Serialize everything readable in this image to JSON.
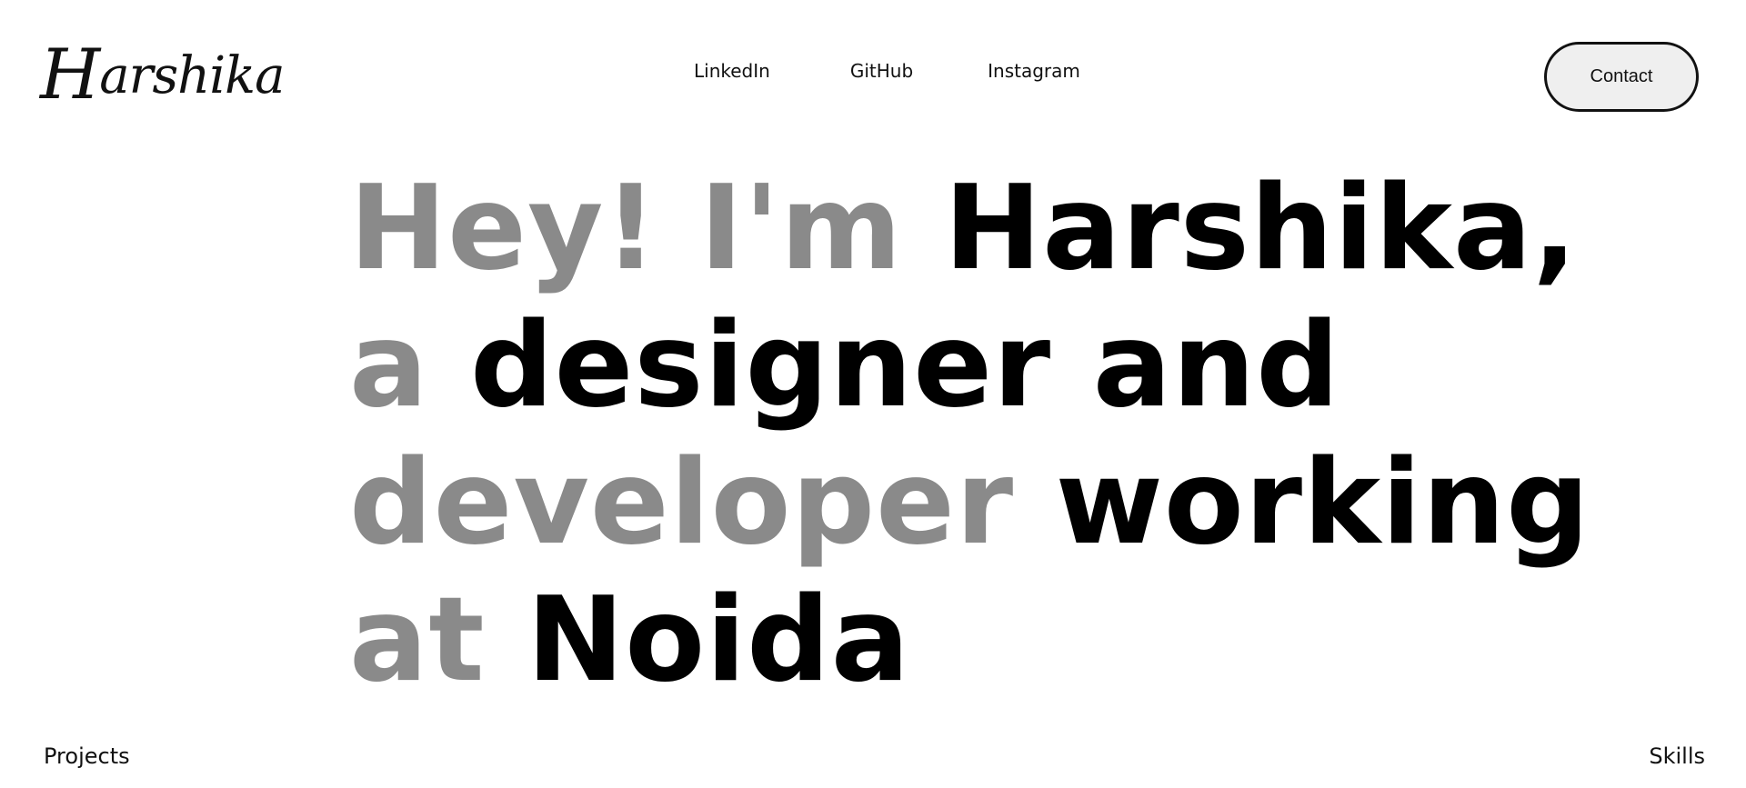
{
  "logo": {
    "cap": "H",
    "rest": "arshika"
  },
  "nav": {
    "linkedin": "LinkedIn",
    "github": "GitHub",
    "instagram": "Instagram"
  },
  "contact_button": "Contact",
  "hero": {
    "line1": {
      "muted": "Hey! I'm ",
      "strong": "Harshika,"
    },
    "line2": {
      "muted": "a ",
      "strong": "designer and"
    },
    "line3": {
      "muted": "developer ",
      "strong": "working"
    },
    "line4": {
      "muted": "at ",
      "strong": "Noida"
    }
  },
  "footer": {
    "projects": "Projects",
    "skills": "Skills"
  },
  "colors": {
    "background": "#ffffff",
    "muted_text": "#8a8a8a",
    "strong_text": "#000000",
    "button_fill": "#efefef"
  }
}
